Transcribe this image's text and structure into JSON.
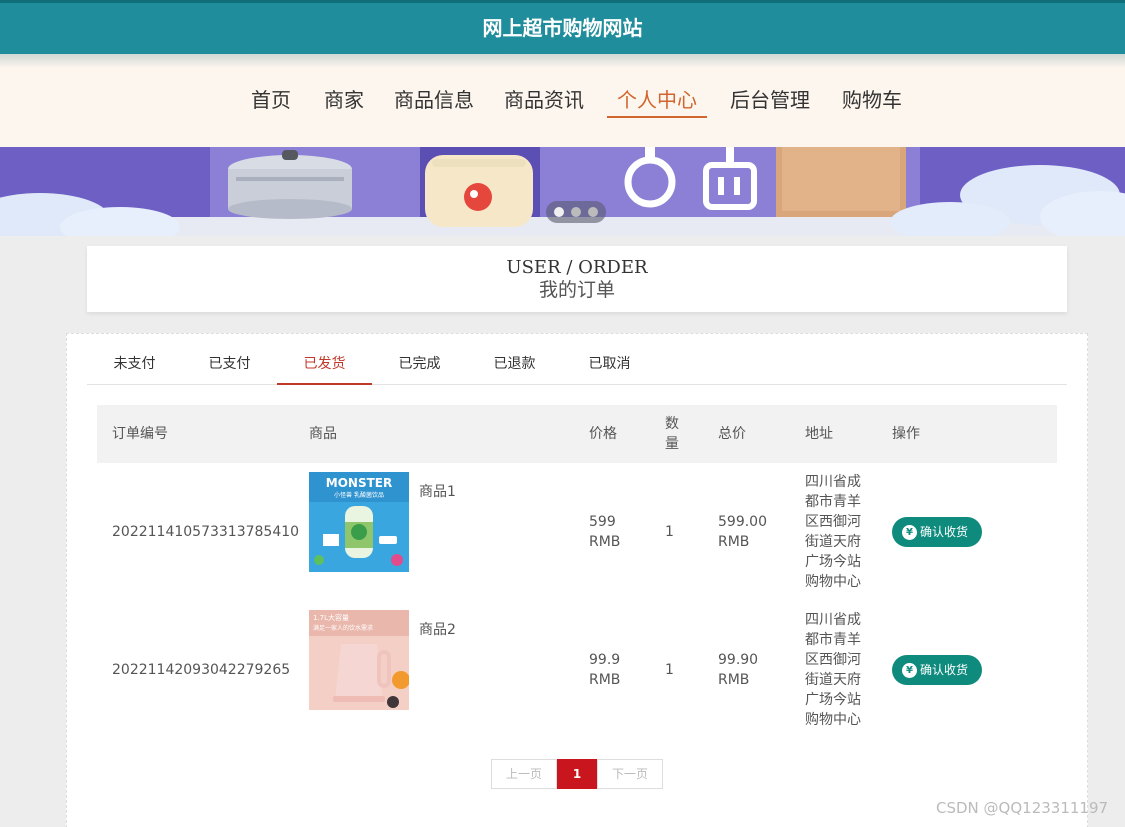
{
  "site": {
    "title": "网上超市购物网站"
  },
  "nav": {
    "items": [
      {
        "label": "首页",
        "active": false
      },
      {
        "label": "商家",
        "active": false
      },
      {
        "label": "商品信息",
        "active": false
      },
      {
        "label": "商品资讯",
        "active": false
      },
      {
        "label": "个人中心",
        "active": true
      },
      {
        "label": "后台管理",
        "active": false
      },
      {
        "label": "购物车",
        "active": false
      }
    ]
  },
  "banner": {
    "slide_count": 3,
    "active_slide": 1
  },
  "page_title": {
    "en": "USER / ORDER",
    "cn": "我的订单"
  },
  "tabs": {
    "items": [
      {
        "label": "未支付",
        "active": false
      },
      {
        "label": "已支付",
        "active": false
      },
      {
        "label": "已发货",
        "active": true
      },
      {
        "label": "已完成",
        "active": false
      },
      {
        "label": "已退款",
        "active": false
      },
      {
        "label": "已取消",
        "active": false
      }
    ]
  },
  "table": {
    "headers": {
      "order_no": "订单编号",
      "product": "商品",
      "price": "价格",
      "qty": "数量",
      "total": "总价",
      "address": "地址",
      "action": "操作"
    },
    "rows": [
      {
        "order_no": "20221141057331378541​0",
        "product_name": "商品1",
        "price": "599",
        "price_unit": "RMB",
        "qty": "1",
        "total": "599.00",
        "total_unit": "RMB",
        "address": "四川省成都市青羊区西御河街道天府广场今站购物中心",
        "action": "确认收货"
      },
      {
        "order_no": "20221142093042279265",
        "product_name": "商品2",
        "price": "99.9",
        "price_unit": "RMB",
        "qty": "1",
        "total": "99.90",
        "total_unit": "RMB",
        "address": "四川省成都市青羊区西御河街道天府广场今站购物中心",
        "action": "确认收货"
      }
    ]
  },
  "product_images": {
    "p1": {
      "brand_text": "MONSTER",
      "sub_text": "小怪兽 乳酸菌饮品"
    },
    "p2": {
      "line1": "1.7L大容量",
      "line2": "满足一家人的饮水需求"
    }
  },
  "pagination": {
    "prev": "上一页",
    "current": "1",
    "next": "下一页"
  },
  "watermark": "CSDN @QQ123311197"
}
